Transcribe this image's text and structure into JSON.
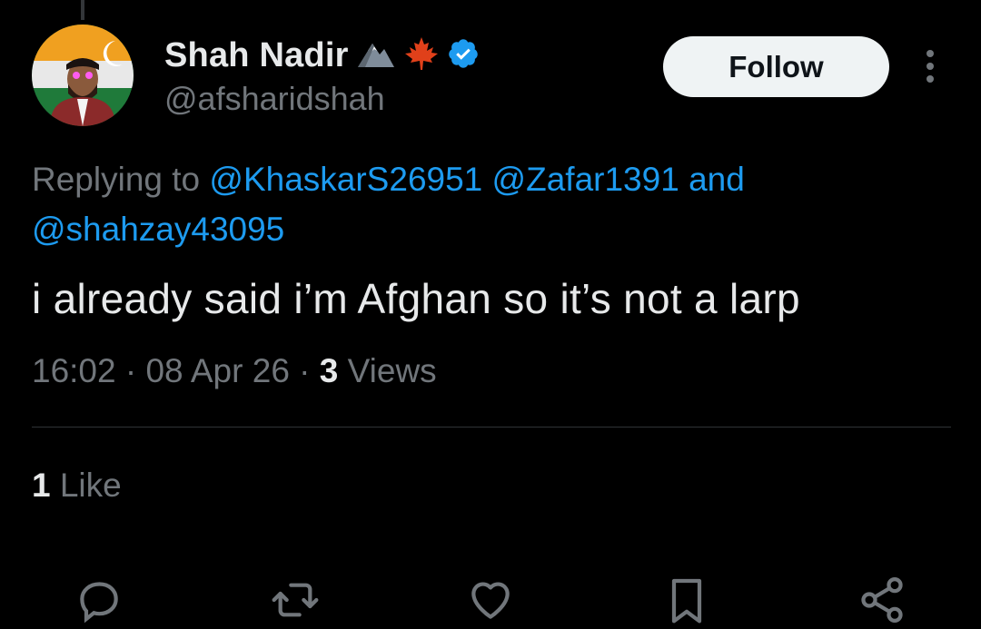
{
  "tweet": {
    "author": {
      "display_name": "Shah Nadir",
      "name_emojis": [
        "mountain-icon",
        "maple-leaf-icon"
      ],
      "verified": true,
      "handle": "@afsharidshah"
    },
    "follow_label": "Follow",
    "replying_prefix": "Replying to",
    "replying_mentions": [
      "@KhaskarS26951",
      "@Zafar1391"
    ],
    "replying_and": "and",
    "replying_mention_last": "@shahzay43095",
    "text": "i already said i’m Afghan so it’s not a larp",
    "time": "16:02",
    "date": "08 Apr 26",
    "separator": "·",
    "views_count": "3",
    "views_label": "Views",
    "likes_count": "1",
    "likes_label": "Like"
  },
  "actions": [
    "reply-icon",
    "retweet-icon",
    "like-icon",
    "bookmark-icon",
    "share-icon"
  ],
  "colors": {
    "background": "#000000",
    "text_primary": "#e7e9ea",
    "text_secondary": "#71767b",
    "accent": "#1d9bf0",
    "button_bg": "#eff3f4"
  }
}
